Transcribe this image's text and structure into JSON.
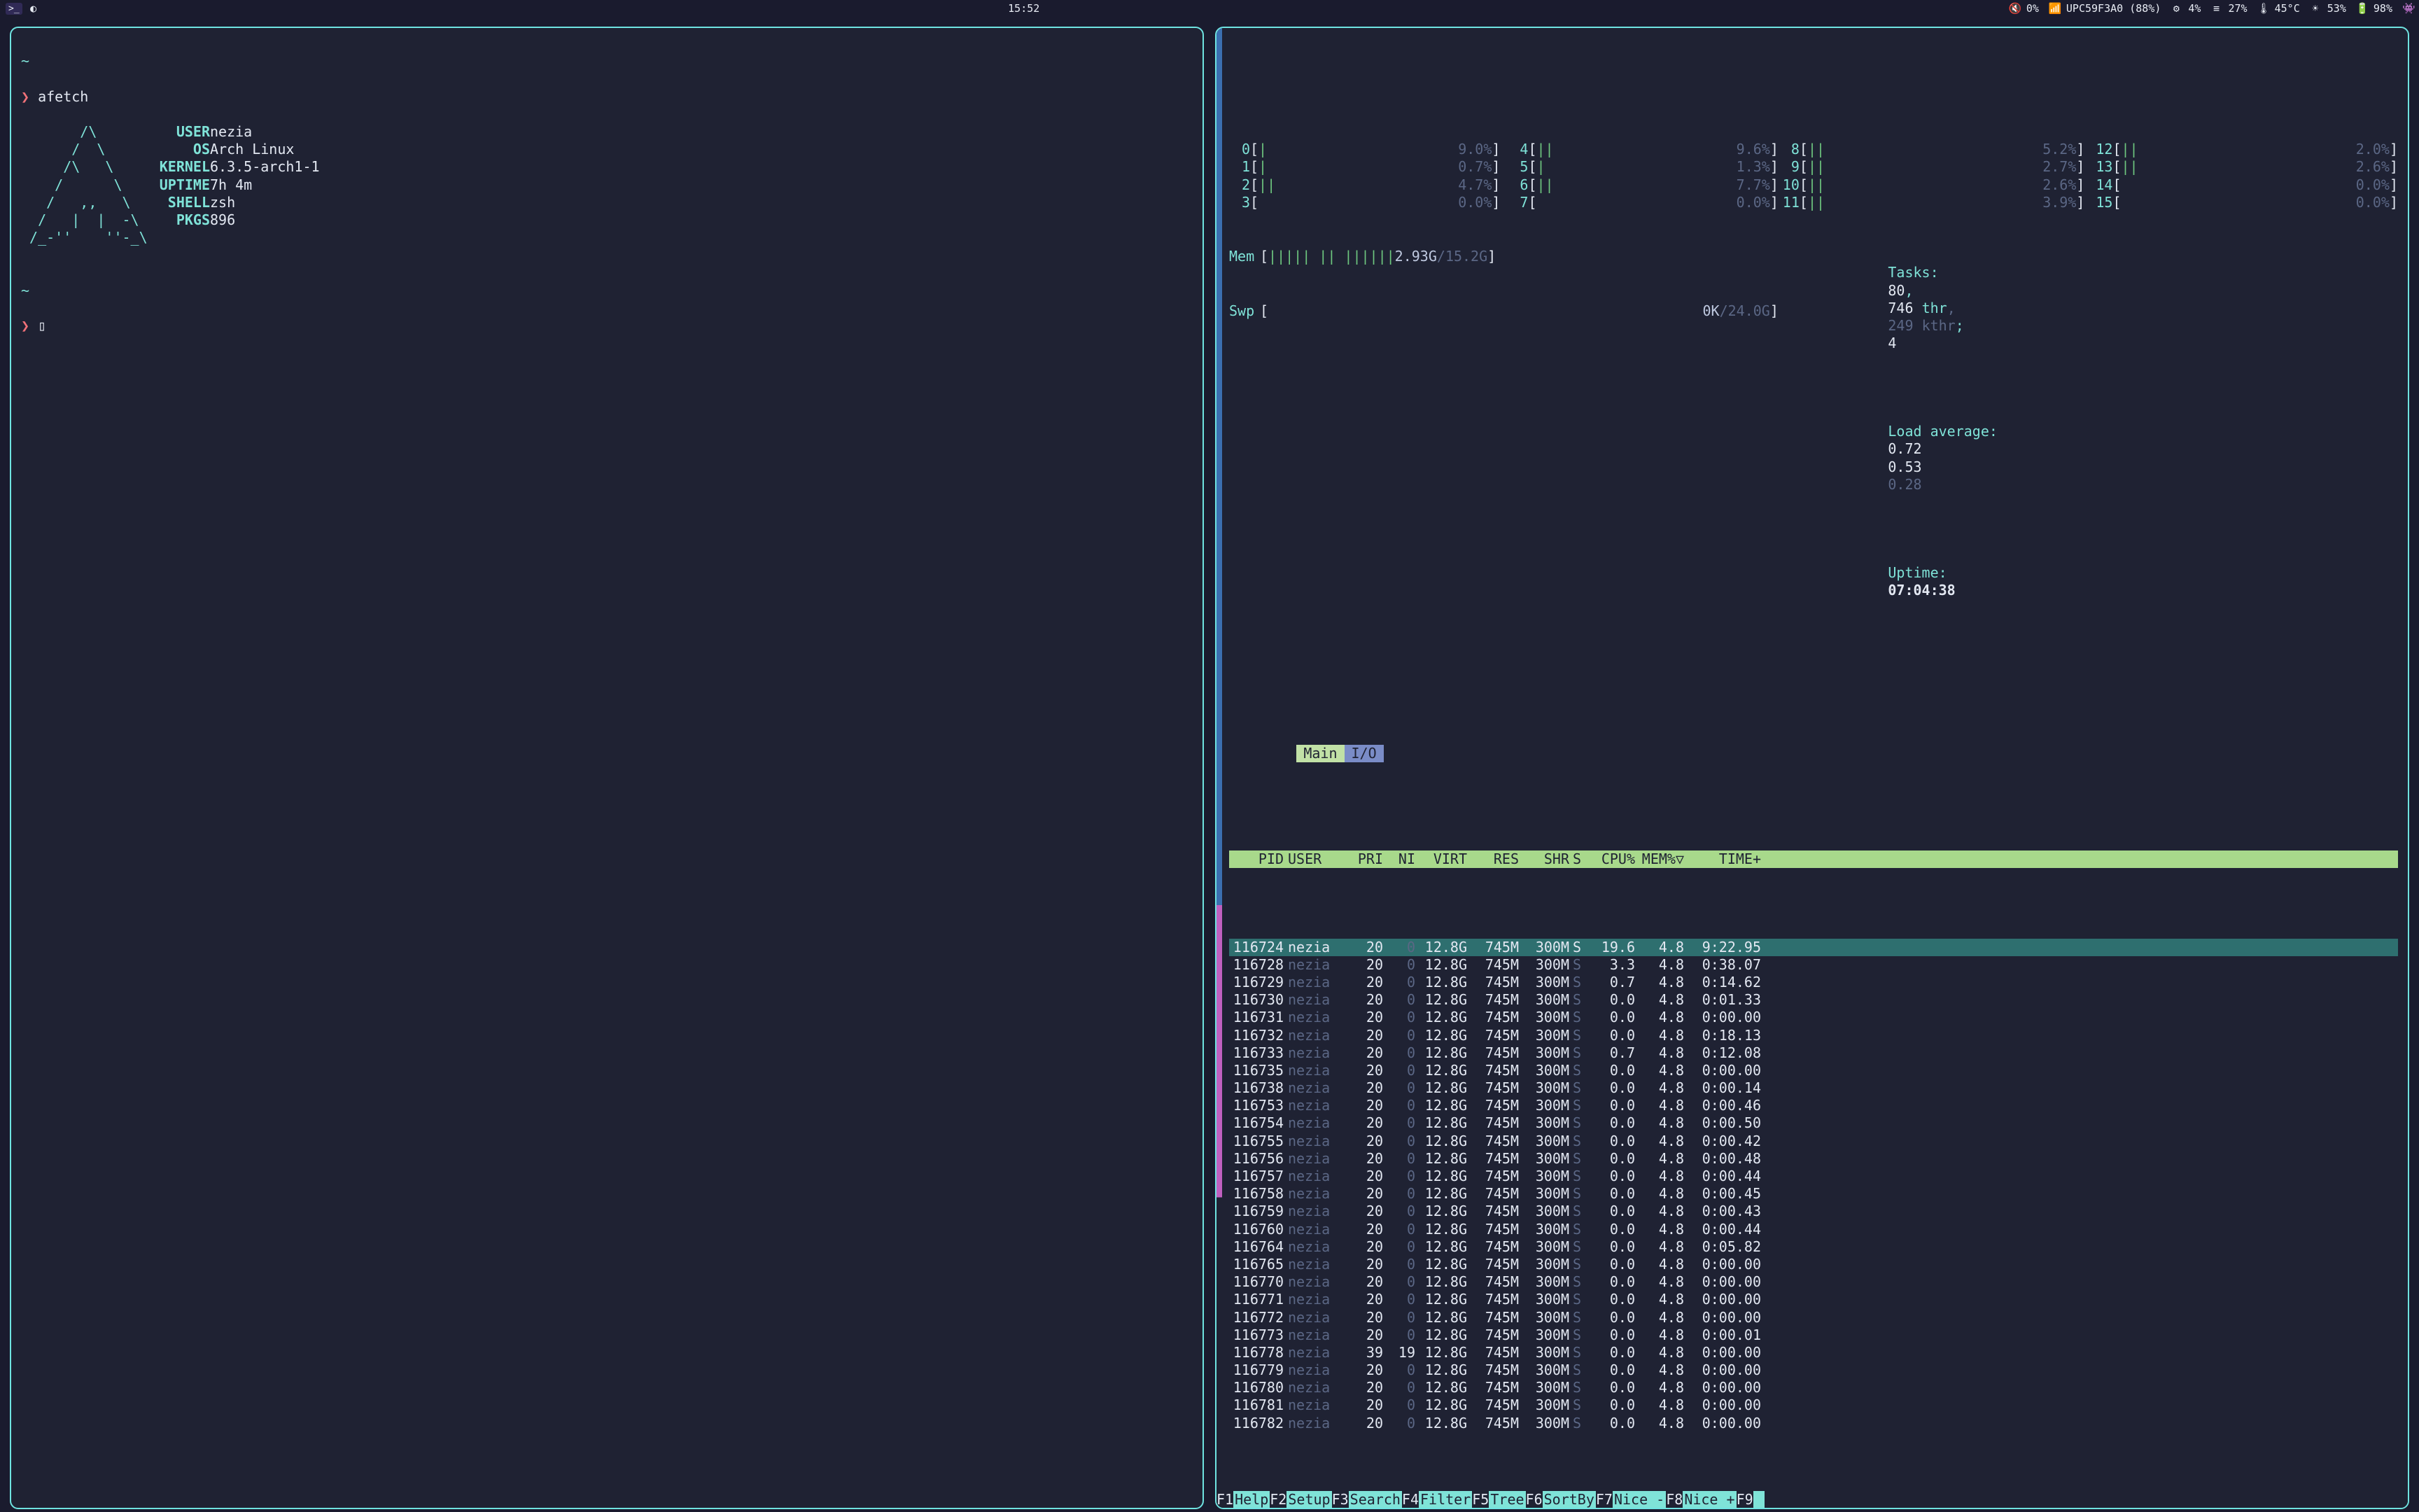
{
  "topbar": {
    "clock": "15:52",
    "vol_pct": "0%",
    "wifi": "UPC59F3A0 (88%)",
    "gear_pct": "4%",
    "menu_pct": "27%",
    "temp": "45°C",
    "bright_pct": "53%",
    "batt_pct": "98%"
  },
  "afetch": {
    "cmd": "afetch",
    "art": [
      "~",
      "",
      "       /\\",
      "      /  \\",
      "     /\\   \\",
      "    /      \\",
      "   /   ,,   \\",
      "  /   |  |  -\\",
      " /_-''    ''-_\\",
      "",
      "~",
      ""
    ],
    "kv": [
      {
        "k": "USER",
        "v": "nezia"
      },
      {
        "k": "OS",
        "v": "Arch Linux"
      },
      {
        "k": "KERNEL",
        "v": "6.3.5-arch1-1"
      },
      {
        "k": "UPTIME",
        "v": "7h 4m"
      },
      {
        "k": "SHELL",
        "v": "zsh"
      },
      {
        "k": "PKGS",
        "v": "896"
      }
    ],
    "prompt_tilde": "~",
    "prompt_arrow": "❯",
    "cursor": "▯"
  },
  "htop": {
    "cpu_cols": [
      [
        {
          "n": "0",
          "bar": "|",
          "pct": "9.0%"
        },
        {
          "n": "1",
          "bar": "|",
          "pct": "0.7%"
        },
        {
          "n": "2",
          "bar": "||",
          "pct": "4.7%"
        },
        {
          "n": "3",
          "bar": "",
          "pct": "0.0%"
        }
      ],
      [
        {
          "n": "4",
          "bar": "||",
          "pct": "9.6%"
        },
        {
          "n": "5",
          "bar": "|",
          "pct": "1.3%"
        },
        {
          "n": "6",
          "bar": "||",
          "pct": "7.7%"
        },
        {
          "n": "7",
          "bar": "",
          "pct": "0.0%"
        }
      ],
      [
        {
          "n": "8",
          "bar": "||",
          "pct": "5.2%"
        },
        {
          "n": "9",
          "bar": "||",
          "pct": "2.7%"
        },
        {
          "n": "10",
          "bar": "||",
          "pct": "2.6%"
        },
        {
          "n": "11",
          "bar": "||",
          "pct": "3.9%"
        }
      ],
      [
        {
          "n": "12",
          "bar": "||",
          "pct": "2.0%"
        },
        {
          "n": "13",
          "bar": "||",
          "pct": "2.6%"
        },
        {
          "n": "14",
          "bar": "",
          "pct": "0.0%"
        },
        {
          "n": "15",
          "bar": "",
          "pct": "0.0%"
        }
      ]
    ],
    "mem": {
      "label": "Mem",
      "bar": "||||| || ||||||",
      "used": "2.93G",
      "total": "15.2G"
    },
    "swp": {
      "label": "Swp",
      "used": "0K",
      "total": "24.0G"
    },
    "tasks": {
      "label": "Tasks:",
      "procs": "80",
      "thr": "746",
      "thr_lbl": "thr",
      "kthr": "249",
      "kthr_lbl": "kthr",
      "running": "4"
    },
    "load": {
      "label": "Load average:",
      "a": "0.72",
      "b": "0.53",
      "c": "0.28"
    },
    "uptime": {
      "label": "Uptime:",
      "val": "07:04:38"
    },
    "tabs": {
      "main": "Main",
      "io": "I/O"
    },
    "header": [
      "PID",
      "USER",
      "PRI",
      "NI",
      "VIRT",
      "RES",
      "SHR",
      "S",
      "CPU%",
      "MEM%▽",
      "TIME+"
    ],
    "rows": [
      {
        "pid": "116724",
        "user": "nezia",
        "pri": "20",
        "ni": "0",
        "virt": "12.8G",
        "res": "745M",
        "shr": "300M",
        "s": "S",
        "cpu": "19.6",
        "mem": "4.8",
        "time": "9:22.95",
        "sel": true
      },
      {
        "pid": "116728",
        "user": "nezia",
        "pri": "20",
        "ni": "0",
        "virt": "12.8G",
        "res": "745M",
        "shr": "300M",
        "s": "S",
        "cpu": "3.3",
        "mem": "4.8",
        "time": "0:38.07"
      },
      {
        "pid": "116729",
        "user": "nezia",
        "pri": "20",
        "ni": "0",
        "virt": "12.8G",
        "res": "745M",
        "shr": "300M",
        "s": "S",
        "cpu": "0.7",
        "mem": "4.8",
        "time": "0:14.62"
      },
      {
        "pid": "116730",
        "user": "nezia",
        "pri": "20",
        "ni": "0",
        "virt": "12.8G",
        "res": "745M",
        "shr": "300M",
        "s": "S",
        "cpu": "0.0",
        "mem": "4.8",
        "time": "0:01.33"
      },
      {
        "pid": "116731",
        "user": "nezia",
        "pri": "20",
        "ni": "0",
        "virt": "12.8G",
        "res": "745M",
        "shr": "300M",
        "s": "S",
        "cpu": "0.0",
        "mem": "4.8",
        "time": "0:00.00"
      },
      {
        "pid": "116732",
        "user": "nezia",
        "pri": "20",
        "ni": "0",
        "virt": "12.8G",
        "res": "745M",
        "shr": "300M",
        "s": "S",
        "cpu": "0.0",
        "mem": "4.8",
        "time": "0:18.13"
      },
      {
        "pid": "116733",
        "user": "nezia",
        "pri": "20",
        "ni": "0",
        "virt": "12.8G",
        "res": "745M",
        "shr": "300M",
        "s": "S",
        "cpu": "0.7",
        "mem": "4.8",
        "time": "0:12.08"
      },
      {
        "pid": "116735",
        "user": "nezia",
        "pri": "20",
        "ni": "0",
        "virt": "12.8G",
        "res": "745M",
        "shr": "300M",
        "s": "S",
        "cpu": "0.0",
        "mem": "4.8",
        "time": "0:00.00"
      },
      {
        "pid": "116738",
        "user": "nezia",
        "pri": "20",
        "ni": "0",
        "virt": "12.8G",
        "res": "745M",
        "shr": "300M",
        "s": "S",
        "cpu": "0.0",
        "mem": "4.8",
        "time": "0:00.14"
      },
      {
        "pid": "116753",
        "user": "nezia",
        "pri": "20",
        "ni": "0",
        "virt": "12.8G",
        "res": "745M",
        "shr": "300M",
        "s": "S",
        "cpu": "0.0",
        "mem": "4.8",
        "time": "0:00.46"
      },
      {
        "pid": "116754",
        "user": "nezia",
        "pri": "20",
        "ni": "0",
        "virt": "12.8G",
        "res": "745M",
        "shr": "300M",
        "s": "S",
        "cpu": "0.0",
        "mem": "4.8",
        "time": "0:00.50"
      },
      {
        "pid": "116755",
        "user": "nezia",
        "pri": "20",
        "ni": "0",
        "virt": "12.8G",
        "res": "745M",
        "shr": "300M",
        "s": "S",
        "cpu": "0.0",
        "mem": "4.8",
        "time": "0:00.42"
      },
      {
        "pid": "116756",
        "user": "nezia",
        "pri": "20",
        "ni": "0",
        "virt": "12.8G",
        "res": "745M",
        "shr": "300M",
        "s": "S",
        "cpu": "0.0",
        "mem": "4.8",
        "time": "0:00.48"
      },
      {
        "pid": "116757",
        "user": "nezia",
        "pri": "20",
        "ni": "0",
        "virt": "12.8G",
        "res": "745M",
        "shr": "300M",
        "s": "S",
        "cpu": "0.0",
        "mem": "4.8",
        "time": "0:00.44"
      },
      {
        "pid": "116758",
        "user": "nezia",
        "pri": "20",
        "ni": "0",
        "virt": "12.8G",
        "res": "745M",
        "shr": "300M",
        "s": "S",
        "cpu": "0.0",
        "mem": "4.8",
        "time": "0:00.45"
      },
      {
        "pid": "116759",
        "user": "nezia",
        "pri": "20",
        "ni": "0",
        "virt": "12.8G",
        "res": "745M",
        "shr": "300M",
        "s": "S",
        "cpu": "0.0",
        "mem": "4.8",
        "time": "0:00.43"
      },
      {
        "pid": "116760",
        "user": "nezia",
        "pri": "20",
        "ni": "0",
        "virt": "12.8G",
        "res": "745M",
        "shr": "300M",
        "s": "S",
        "cpu": "0.0",
        "mem": "4.8",
        "time": "0:00.44"
      },
      {
        "pid": "116764",
        "user": "nezia",
        "pri": "20",
        "ni": "0",
        "virt": "12.8G",
        "res": "745M",
        "shr": "300M",
        "s": "S",
        "cpu": "0.0",
        "mem": "4.8",
        "time": "0:05.82"
      },
      {
        "pid": "116765",
        "user": "nezia",
        "pri": "20",
        "ni": "0",
        "virt": "12.8G",
        "res": "745M",
        "shr": "300M",
        "s": "S",
        "cpu": "0.0",
        "mem": "4.8",
        "time": "0:00.00"
      },
      {
        "pid": "116770",
        "user": "nezia",
        "pri": "20",
        "ni": "0",
        "virt": "12.8G",
        "res": "745M",
        "shr": "300M",
        "s": "S",
        "cpu": "0.0",
        "mem": "4.8",
        "time": "0:00.00"
      },
      {
        "pid": "116771",
        "user": "nezia",
        "pri": "20",
        "ni": "0",
        "virt": "12.8G",
        "res": "745M",
        "shr": "300M",
        "s": "S",
        "cpu": "0.0",
        "mem": "4.8",
        "time": "0:00.00"
      },
      {
        "pid": "116772",
        "user": "nezia",
        "pri": "20",
        "ni": "0",
        "virt": "12.8G",
        "res": "745M",
        "shr": "300M",
        "s": "S",
        "cpu": "0.0",
        "mem": "4.8",
        "time": "0:00.00"
      },
      {
        "pid": "116773",
        "user": "nezia",
        "pri": "20",
        "ni": "0",
        "virt": "12.8G",
        "res": "745M",
        "shr": "300M",
        "s": "S",
        "cpu": "0.0",
        "mem": "4.8",
        "time": "0:00.01"
      },
      {
        "pid": "116778",
        "user": "nezia",
        "pri": "39",
        "ni": "19",
        "virt": "12.8G",
        "res": "745M",
        "shr": "300M",
        "s": "S",
        "cpu": "0.0",
        "mem": "4.8",
        "time": "0:00.00"
      },
      {
        "pid": "116779",
        "user": "nezia",
        "pri": "20",
        "ni": "0",
        "virt": "12.8G",
        "res": "745M",
        "shr": "300M",
        "s": "S",
        "cpu": "0.0",
        "mem": "4.8",
        "time": "0:00.00"
      },
      {
        "pid": "116780",
        "user": "nezia",
        "pri": "20",
        "ni": "0",
        "virt": "12.8G",
        "res": "745M",
        "shr": "300M",
        "s": "S",
        "cpu": "0.0",
        "mem": "4.8",
        "time": "0:00.00"
      },
      {
        "pid": "116781",
        "user": "nezia",
        "pri": "20",
        "ni": "0",
        "virt": "12.8G",
        "res": "745M",
        "shr": "300M",
        "s": "S",
        "cpu": "0.0",
        "mem": "4.8",
        "time": "0:00.00"
      },
      {
        "pid": "116782",
        "user": "nezia",
        "pri": "20",
        "ni": "0",
        "virt": "12.8G",
        "res": "745M",
        "shr": "300M",
        "s": "S",
        "cpu": "0.0",
        "mem": "4.8",
        "time": "0:00.00"
      }
    ],
    "fn": [
      {
        "k": "F1",
        "l": "Help"
      },
      {
        "k": "F2",
        "l": "Setup"
      },
      {
        "k": "F3",
        "l": "Search"
      },
      {
        "k": "F4",
        "l": "Filter"
      },
      {
        "k": "F5",
        "l": "Tree"
      },
      {
        "k": "F6",
        "l": "SortBy"
      },
      {
        "k": "F7",
        "l": "Nice -"
      },
      {
        "k": "F8",
        "l": "Nice +"
      },
      {
        "k": "F9",
        "l": ""
      }
    ]
  }
}
